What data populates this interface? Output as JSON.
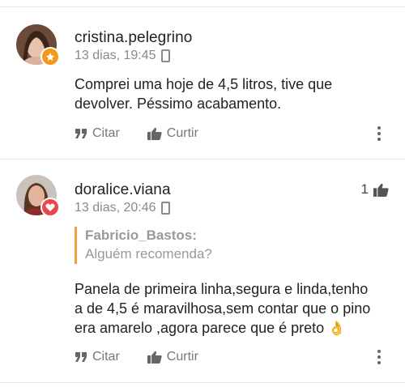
{
  "posts": [
    {
      "username": "cristina.pelegrino",
      "time": "13 dias, 19:45",
      "body": "Comprei uma hoje de 4,5 litros, tive que devolver. Péssimo acabamento.",
      "actions": {
        "quote": "Citar",
        "like": "Curtir"
      },
      "badge_color": "#f39a1e"
    },
    {
      "username": "doralice.viana",
      "time": "13 dias, 20:46",
      "likes": "1",
      "quote": {
        "author": "Fabricio_Bastos:",
        "text": "Alguém recomenda?"
      },
      "body_line1": "Panela de primeira linha,segura  e linda,tenho",
      "body_line2": "a de 4,5 é maravilhosa,sem contar  que o pino",
      "body_line3": "era amarelo ,agora parece que é preto",
      "emoji": "👌",
      "actions": {
        "quote": "Citar",
        "like": "Curtir"
      },
      "badge_color": "#e8474f"
    }
  ],
  "icons": [
    "quote-icon",
    "thumbs-up-icon",
    "more-vertical-icon",
    "phone-icon",
    "star-badge-icon",
    "heart-badge-icon"
  ]
}
